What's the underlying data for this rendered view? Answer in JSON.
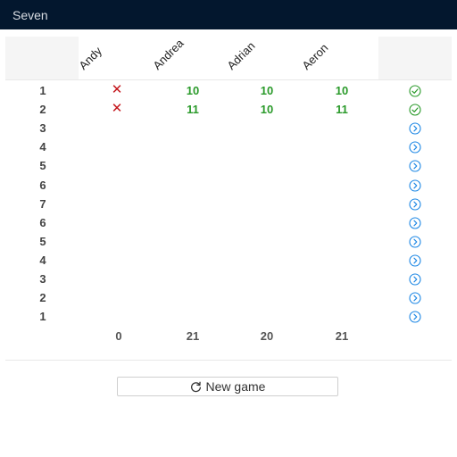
{
  "window": {
    "title": "Seven"
  },
  "players": [
    "Andy",
    "Andrea",
    "Adrian",
    "Aeron"
  ],
  "rounds": [
    {
      "number": "1",
      "scores": [
        "✕",
        "10",
        "10",
        "10"
      ],
      "status": "done"
    },
    {
      "number": "2",
      "scores": [
        "✕",
        "11",
        "10",
        "11"
      ],
      "status": "done"
    },
    {
      "number": "3",
      "scores": [
        "",
        "",
        "",
        ""
      ],
      "status": "pending"
    },
    {
      "number": "4",
      "scores": [
        "",
        "",
        "",
        ""
      ],
      "status": "pending"
    },
    {
      "number": "5",
      "scores": [
        "",
        "",
        "",
        ""
      ],
      "status": "pending"
    },
    {
      "number": "6",
      "scores": [
        "",
        "",
        "",
        ""
      ],
      "status": "pending"
    },
    {
      "number": "7",
      "scores": [
        "",
        "",
        "",
        ""
      ],
      "status": "pending"
    },
    {
      "number": "6",
      "scores": [
        "",
        "",
        "",
        ""
      ],
      "status": "pending"
    },
    {
      "number": "5",
      "scores": [
        "",
        "",
        "",
        ""
      ],
      "status": "pending"
    },
    {
      "number": "4",
      "scores": [
        "",
        "",
        "",
        ""
      ],
      "status": "pending"
    },
    {
      "number": "3",
      "scores": [
        "",
        "",
        "",
        ""
      ],
      "status": "pending"
    },
    {
      "number": "2",
      "scores": [
        "",
        "",
        "",
        ""
      ],
      "status": "pending"
    },
    {
      "number": "1",
      "scores": [
        "",
        "",
        "",
        ""
      ],
      "status": "pending"
    }
  ],
  "totals": [
    "0",
    "21",
    "20",
    "21"
  ],
  "actions": {
    "new_game_label": "New game",
    "new_game_icon": "refresh-icon"
  },
  "icons": {
    "done": "check-circle-icon",
    "pending": "chevron-right-circle-icon"
  },
  "colors": {
    "titlebar": "#03172e",
    "score_green": "#2a9a2a",
    "cross_red": "#c4161c",
    "check_green": "#2a9a2a",
    "chevron_blue": "#1e88e5"
  }
}
